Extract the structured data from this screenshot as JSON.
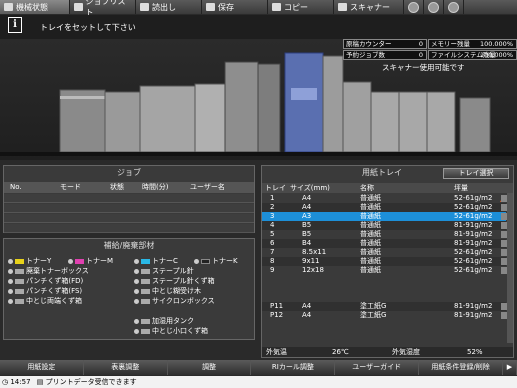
{
  "tabs": [
    {
      "label": "機械状態",
      "active": true
    },
    {
      "label": "ジョブリスト",
      "active": false
    },
    {
      "label": "読出し",
      "active": false
    },
    {
      "label": "保存",
      "active": false
    },
    {
      "label": "コピー",
      "active": false
    },
    {
      "label": "スキャナー",
      "active": false
    }
  ],
  "message": {
    "text": "トレイをセットして下さい"
  },
  "counters": {
    "original_counter_label": "原稿カウンター",
    "original_counter_value": "0",
    "memory_label": "メモリー残量",
    "memory_value": "100.000%",
    "reserved_jobs_label": "予約ジョブ数",
    "reserved_jobs_value": "0",
    "file_system_label": "ファイルシステム残量",
    "file_system_value": "100.000%"
  },
  "scanner_status": "スキャナー使用可能です",
  "job_panel": {
    "title": "ジョブ",
    "headers": [
      "No.",
      "モード",
      "状態",
      "時間(分)",
      "ユーザー名"
    ]
  },
  "supply_panel": {
    "title": "補給/廃棄部材",
    "left_items": [
      "トナーY",
      "廃棄トナーボックス",
      "パンチくず箱(FD)",
      "パンチくず箱(FS)",
      "中とじ両端くず箱"
    ],
    "toner_m": "トナーM",
    "toner_c": "トナーC",
    "toner_k": "トナーK",
    "right_items": [
      "ステープル針",
      "ステープル針くず箱",
      "中とじ糊受け木",
      "サイクロンボックス"
    ],
    "bottom_items": [
      "加湿用タンク",
      "中とじ小口くず箱"
    ],
    "colors": {
      "yellow": "#e8d21a",
      "magenta": "#e040b0",
      "cyan": "#2ab8e6",
      "black": "#222222"
    }
  },
  "tray_panel": {
    "title": "用紙トレイ",
    "select_button": "トレイ選択",
    "headers": [
      "トレイ",
      "サイズ(mm)",
      "名称",
      "坪量"
    ],
    "rows": [
      {
        "tray": "1",
        "size": "A4",
        "name": "普通紙",
        "weight": "52-61g/m2",
        "selected": false
      },
      {
        "tray": "2",
        "size": "A4",
        "name": "普通紙",
        "weight": "52-61g/m2",
        "selected": false
      },
      {
        "tray": "3",
        "size": "A3",
        "name": "普通紙",
        "weight": "52-61g/m2",
        "selected": true
      },
      {
        "tray": "4",
        "size": "B5",
        "name": "普通紙",
        "weight": "81-91g/m2",
        "selected": false
      },
      {
        "tray": "5",
        "size": "B5",
        "name": "普通紙",
        "weight": "81-91g/m2",
        "selected": false
      },
      {
        "tray": "6",
        "size": "B4",
        "name": "普通紙",
        "weight": "81-91g/m2",
        "selected": false
      },
      {
        "tray": "7",
        "size": "8.5x11",
        "name": "普通紙",
        "weight": "52-61g/m2",
        "selected": false
      },
      {
        "tray": "8",
        "size": "9x11",
        "name": "普通紙",
        "weight": "52-61g/m2",
        "selected": false
      },
      {
        "tray": "9",
        "size": "12x18",
        "name": "普通紙",
        "weight": "52-61g/m2",
        "selected": false
      },
      {
        "tray": "P11",
        "size": "A4",
        "name": "塗工紙G",
        "weight": "81-91g/m2",
        "selected": false
      },
      {
        "tray": "P12",
        "size": "A4",
        "name": "塗工紙G",
        "weight": "81-91g/m2",
        "selected": false
      }
    ],
    "outside_temp_label": "外気温",
    "outside_temp_value": "26℃",
    "outside_humidity_label": "外気湿度",
    "outside_humidity_value": "52%"
  },
  "bottom_buttons": [
    "用紙設定",
    "表裏調整",
    "調整",
    "RIカール調整",
    "ユーザーガイド",
    "用紙条件登録/削除"
  ],
  "status_bar": {
    "time": "14:57",
    "text": "プリントデータ受信できます"
  }
}
